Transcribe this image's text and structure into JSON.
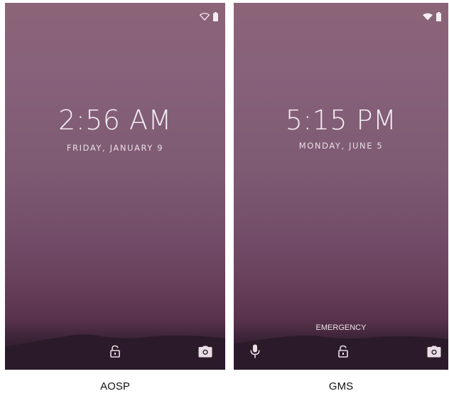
{
  "colors": {
    "wallpaper_top": "#8c6478",
    "wallpaper_bottom": "#241625",
    "foreground": "#f4eef2"
  },
  "screens": [
    {
      "id": "aosp",
      "status_icons": [
        "wifi-outline-icon",
        "battery-icon"
      ],
      "time": "2:56 AM",
      "date": "FRIDAY, JANUARY 9",
      "bottom_icons": [
        "lock-icon",
        "camera-icon"
      ],
      "caption": "AOSP"
    },
    {
      "id": "gms",
      "status_icons": [
        "wifi-filled-icon",
        "battery-icon"
      ],
      "time": "5:15 PM",
      "date": "MONDAY, JUNE 5",
      "emergency": "EMERGENCY",
      "bottom_icons": [
        "microphone-icon",
        "lock-icon",
        "camera-icon"
      ],
      "caption": "GMS"
    }
  ]
}
